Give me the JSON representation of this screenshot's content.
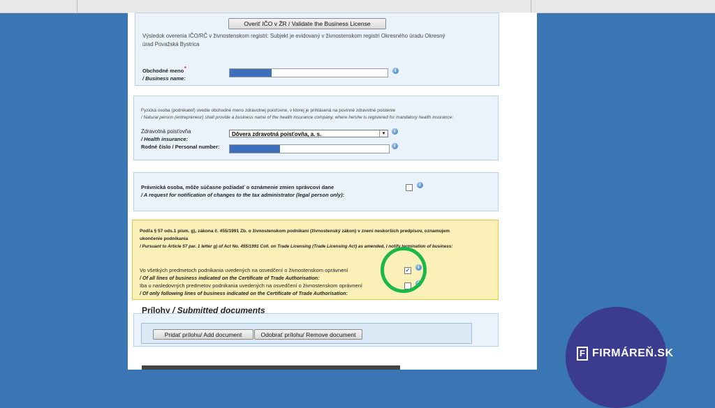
{
  "verification": {
    "button_label": "Overiť IČO v ŽR / Validate the Business License",
    "result_line1": "Výsledok overenia IČO/RČ v živnostenskom registri: Subjekt je evidovaný v živnostenskom registri Okresného úradu Okresný",
    "result_line2": "úrad Považská Bystrica",
    "business_name_label": "Obchodné meno",
    "business_name_required": "*",
    "business_name_label_en": "/ Business name:"
  },
  "insurance": {
    "intro_sk": "Fyzická osoba (podnikateľ) uvedie obchodné meno zdravotnej poisťovne, v ktorej je prihlásená na povinné zdravotné poistenie",
    "intro_en": "/ Natural person (entrepreneur) shall provide a business name of the health insurance company, where he/she is registered for mandatory health insurance:",
    "insurer_label": "Zdravotná poisťovňa",
    "insurer_label_en": "/ Health insurance:",
    "insurer_value": "Dôvera zdravotná poisťovňa, a. s.",
    "personal_number_label": "Rodné číslo / Personal number:"
  },
  "tax_notice": {
    "label_sk": "Právnická osoba, môže súčasne požiadať o oznámenie zmien správcovi dane",
    "label_en": "/ A request for notification of changes to the tax administrator (legal person only):",
    "checked": false
  },
  "termination": {
    "intro_sk_line1": "Podľa § 57 ods.1 písm. g), zákona č. 455/1991 Zb. o živnostenskom podnikaní (živnostenský zákon) v znení neskorších predpisov, oznamujem",
    "intro_sk_line2": "ukončenie podnikania",
    "intro_en": "/ Pursuant to Article 57 par. 1 letter g) of Act No. 455/1991 Coll. on Trade Licensing (Trade Licensing Act) as amended, I notify termination of business:",
    "option_all_sk": "Vo všetkých predmetoch podnikania uvedených na osvedčení o živnostenskom oprávnení",
    "option_all_en": "/ Of all lines of business indicated on the Certificate of Trade Authorisation:",
    "option_all_checked": true,
    "option_some_sk": "Iba u nasledovných predmetov podnikania uvedených na osvedčení o živnostenskom oprávnení",
    "option_some_en": "/ Of only following lines of business indicated on the Certificate of Trade Authorisation:",
    "option_some_checked": false
  },
  "attachments": {
    "heading": "Prílohy",
    "heading_en": "/ Submitted documents",
    "add_label": "Pridať prílohu/ Add document",
    "remove_label": "Odobrať prílohu/ Remove document"
  },
  "icons": {
    "info": "i",
    "check": "✓",
    "dropdown": "▾",
    "logo_mark": "F"
  },
  "brand": {
    "logo_text": "FIRMÁREŇ.SK",
    "badge_color": "#3b3b90",
    "highlight_color": "#1ab84a"
  }
}
